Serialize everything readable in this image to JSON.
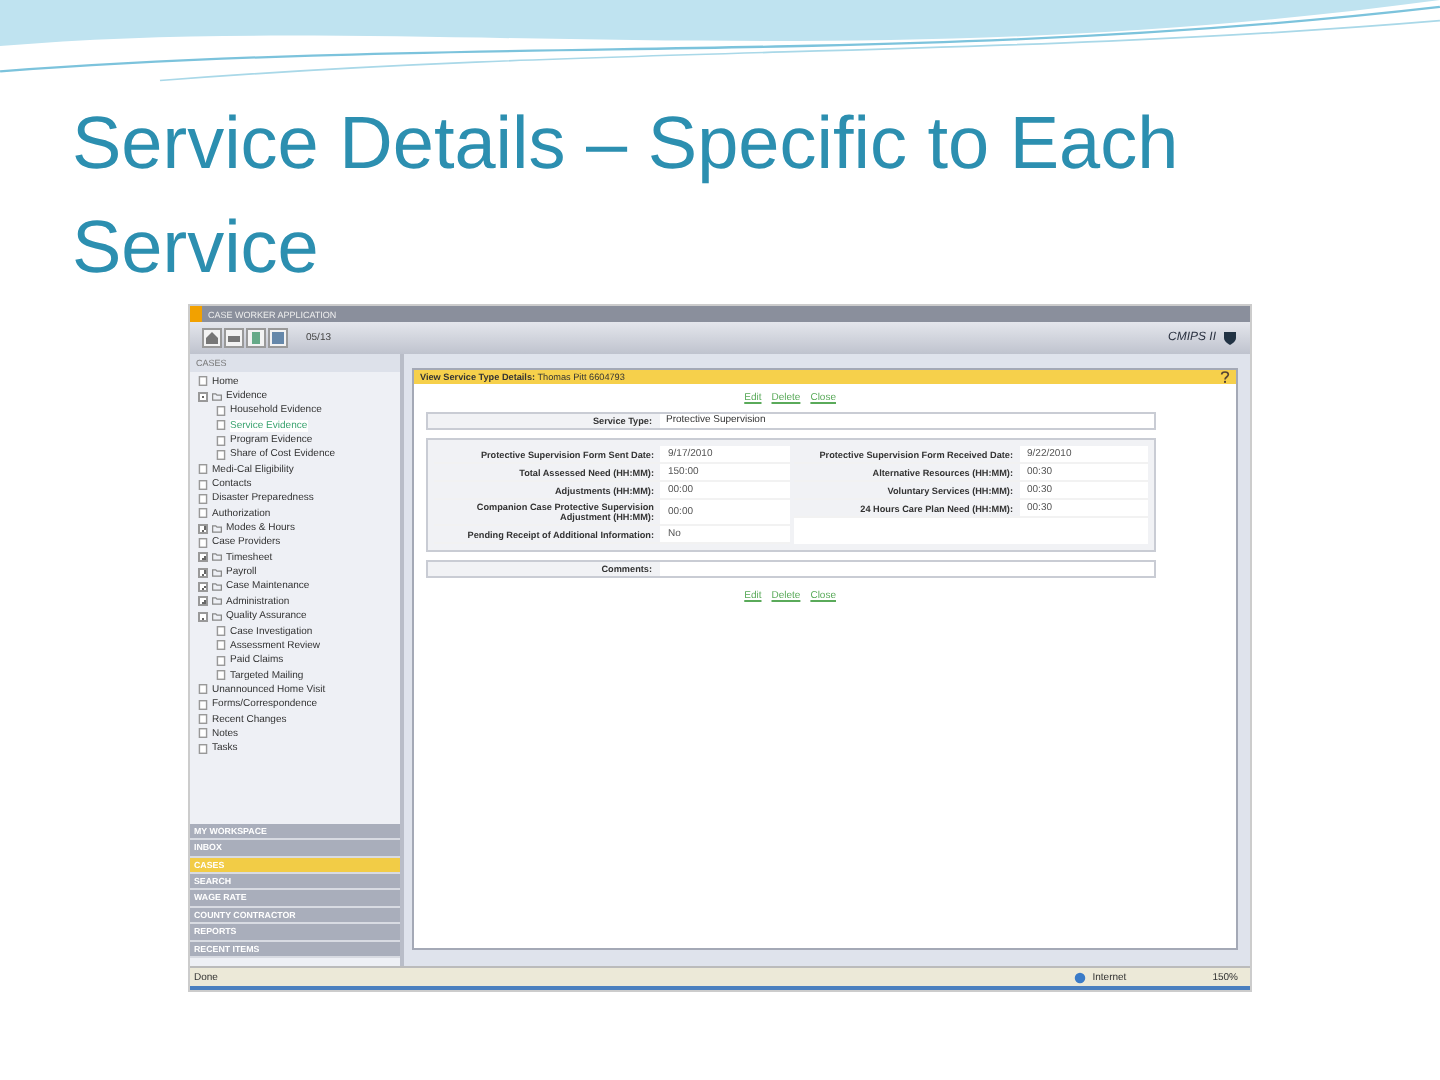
{
  "slide": {
    "title": "Service Details – Specific to Each Service"
  },
  "app": {
    "title": "CASE WORKER APPLICATION",
    "date_field": "05/13",
    "brand": "CMIPS II"
  },
  "sidebar": {
    "heading": "CASES",
    "tree": [
      {
        "label": "Home",
        "selected": false
      },
      {
        "label": "Evidence",
        "selected": false,
        "expanded": true,
        "children": [
          {
            "label": "Household Evidence",
            "selected": false
          },
          {
            "label": "Service Evidence",
            "selected": true
          },
          {
            "label": "Program Evidence",
            "selected": false
          },
          {
            "label": "Share of Cost Evidence",
            "selected": false
          }
        ]
      },
      {
        "label": "Medi-Cal Eligibility",
        "selected": false
      },
      {
        "label": "Contacts",
        "selected": false
      },
      {
        "label": "Disaster Preparedness",
        "selected": false
      },
      {
        "label": "Authorization",
        "selected": false
      },
      {
        "label": "Modes & Hours",
        "selected": false,
        "expanded": false
      },
      {
        "label": "Case Providers",
        "selected": false
      },
      {
        "label": "Timesheet",
        "selected": false,
        "expanded": false
      },
      {
        "label": "Payroll",
        "selected": false,
        "expanded": false
      },
      {
        "label": "Case Maintenance",
        "selected": false,
        "expanded": false
      },
      {
        "label": "Administration",
        "selected": false,
        "expanded": false
      },
      {
        "label": "Quality Assurance",
        "selected": false,
        "expanded": true,
        "children": [
          {
            "label": "Case Investigation",
            "selected": false
          },
          {
            "label": "Assessment Review",
            "selected": false
          },
          {
            "label": "Paid Claims",
            "selected": false
          },
          {
            "label": "Targeted Mailing",
            "selected": false
          }
        ]
      },
      {
        "label": "Unannounced Home Visit",
        "selected": false
      },
      {
        "label": "Forms/Correspondence",
        "selected": false
      },
      {
        "label": "Recent Changes",
        "selected": false
      },
      {
        "label": "Notes",
        "selected": false
      },
      {
        "label": "Tasks",
        "selected": false
      }
    ],
    "sections": [
      {
        "label": "MY WORKSPACE",
        "selected": false
      },
      {
        "label": "INBOX",
        "selected": false
      },
      {
        "label": "CASES",
        "selected": true
      },
      {
        "label": "SEARCH",
        "selected": false
      },
      {
        "label": "WAGE RATE",
        "selected": false
      },
      {
        "label": "COUNTY CONTRACTOR",
        "selected": false
      },
      {
        "label": "REPORTS",
        "selected": false
      },
      {
        "label": "RECENT ITEMS",
        "selected": false
      }
    ]
  },
  "panel": {
    "title": "View Service Type Details:",
    "subject": "Thomas Pitt 6604793",
    "links_top": [
      "Edit",
      "Delete",
      "Close"
    ],
    "service_type": {
      "label": "Service Type:",
      "value": "Protective Supervision"
    },
    "left_fields": [
      {
        "label": "Protective Supervision Form Sent Date:",
        "value": "9/17/2010"
      },
      {
        "label": "Total Assessed Need (HH:MM):",
        "value": "150:00"
      },
      {
        "label": "Adjustments (HH:MM):",
        "value": "00:00"
      },
      {
        "label": "Companion Case Protective Supervision Adjustment (HH:MM):",
        "value": "00:00"
      },
      {
        "label": "Pending Receipt of Additional Information:",
        "value": "No"
      }
    ],
    "right_fields": [
      {
        "label": "Protective Supervision Form Received Date:",
        "value": "9/22/2010"
      },
      {
        "label": "Alternative Resources (HH:MM):",
        "value": "00:30"
      },
      {
        "label": "Voluntary Services (HH:MM):",
        "value": "00:30"
      },
      {
        "label": "24 Hours Care Plan Need (HH:MM):",
        "value": "00:30"
      }
    ],
    "comments": {
      "label": "Comments:"
    },
    "links_bottom": [
      "Edit",
      "Delete",
      "Close"
    ]
  },
  "status_bar": {
    "status": "Done",
    "zone": "Internet",
    "zoom": "150%"
  }
}
